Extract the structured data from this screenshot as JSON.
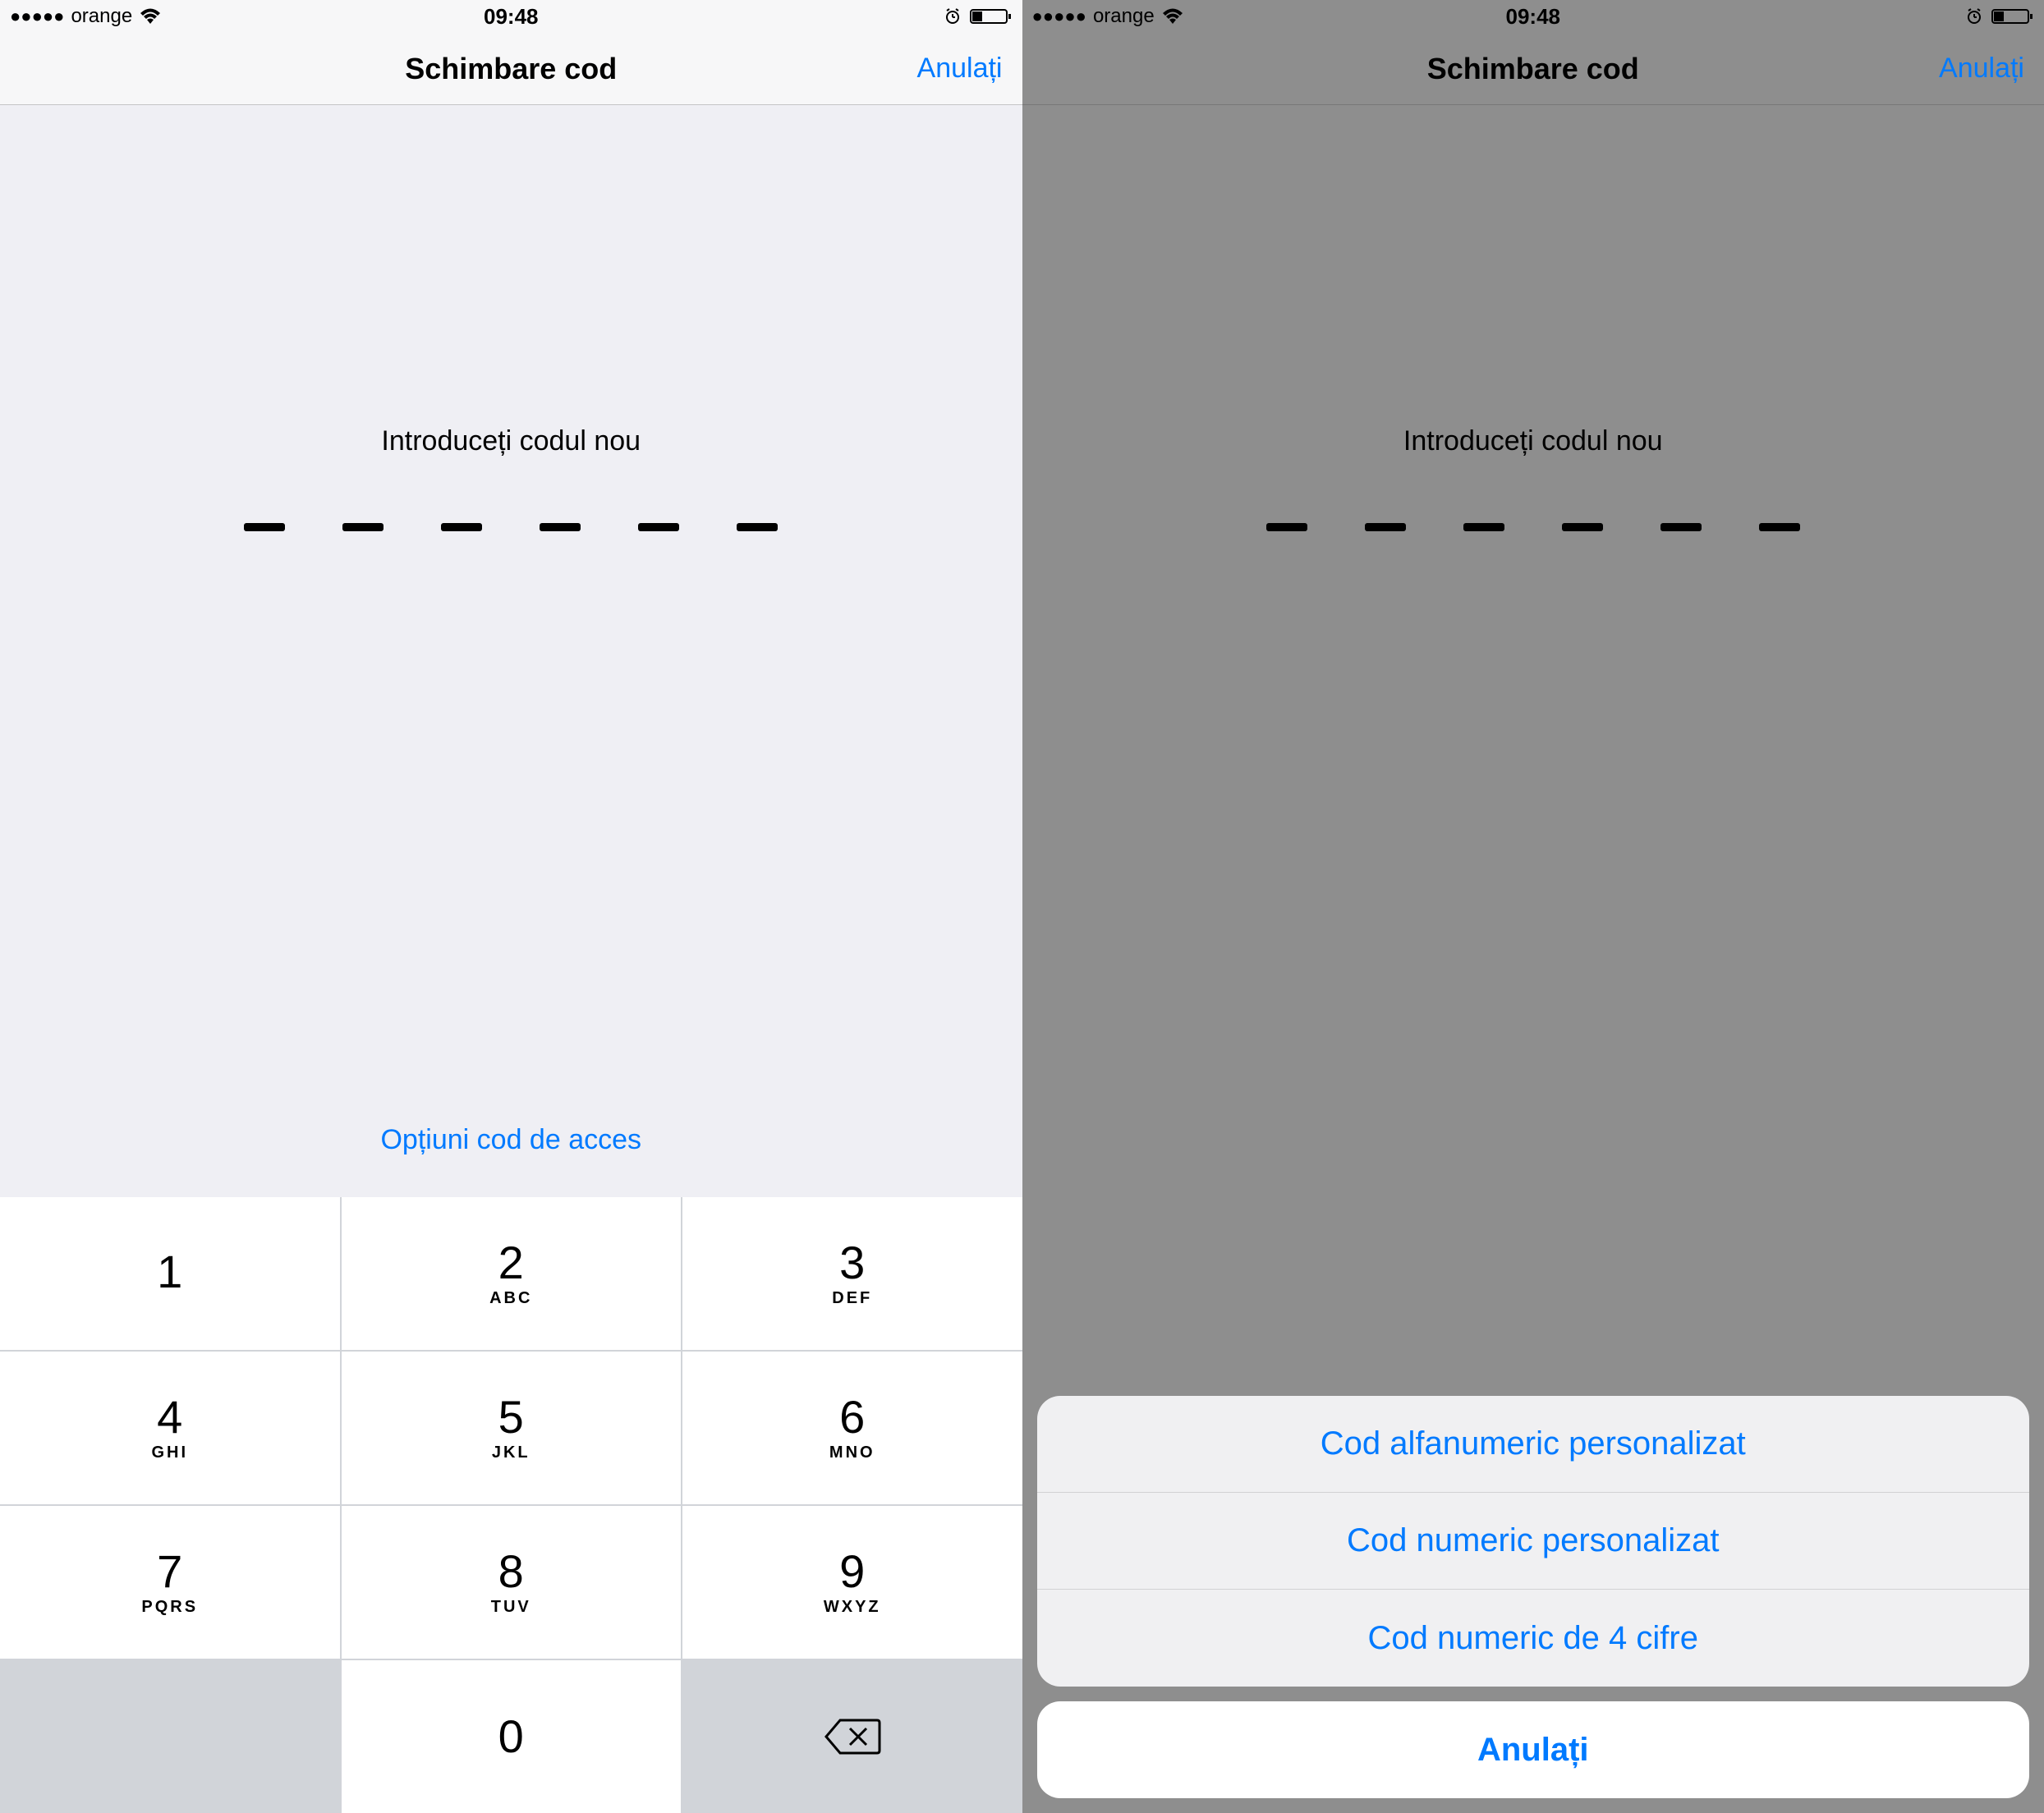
{
  "status": {
    "carrier": "orange",
    "time": "09:48"
  },
  "nav": {
    "title": "Schimbare cod",
    "cancel": "Anulați"
  },
  "content": {
    "prompt": "Introduceți codul nou",
    "options_link": "Opțiuni cod de acces"
  },
  "keypad": {
    "keys": [
      {
        "num": "1",
        "letters": " "
      },
      {
        "num": "2",
        "letters": "ABC"
      },
      {
        "num": "3",
        "letters": "DEF"
      },
      {
        "num": "4",
        "letters": "GHI"
      },
      {
        "num": "5",
        "letters": "JKL"
      },
      {
        "num": "6",
        "letters": "MNO"
      },
      {
        "num": "7",
        "letters": "PQRS"
      },
      {
        "num": "8",
        "letters": "TUV"
      },
      {
        "num": "9",
        "letters": "WXYZ"
      },
      {
        "num": "0",
        "letters": ""
      }
    ]
  },
  "action_sheet": {
    "items": [
      "Cod alfanumeric personalizat",
      "Cod numeric personalizat",
      "Cod numeric de 4 cifre"
    ],
    "cancel": "Anulați"
  }
}
